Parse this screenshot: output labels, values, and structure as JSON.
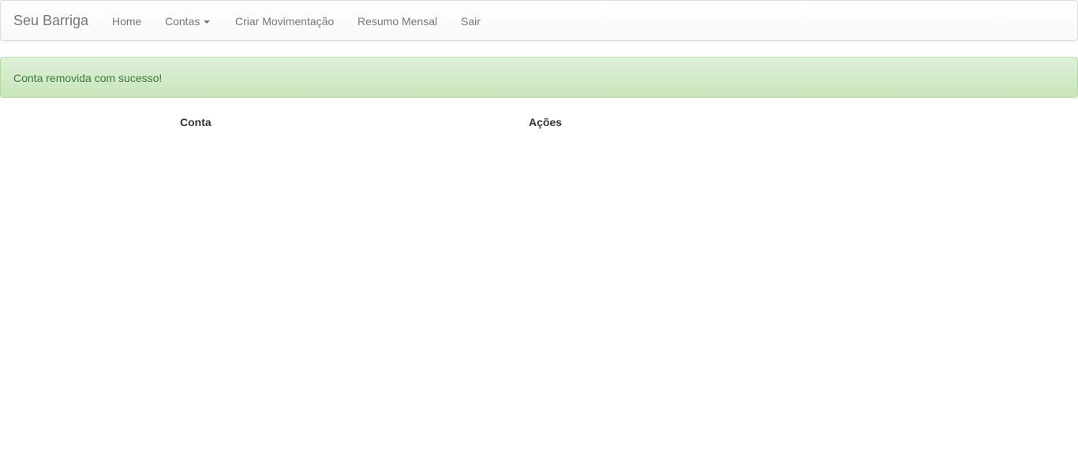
{
  "navbar": {
    "brand": "Seu Barriga",
    "items": [
      {
        "label": "Home"
      },
      {
        "label": "Contas",
        "has_dropdown": true
      },
      {
        "label": "Criar Movimentação"
      },
      {
        "label": "Resumo Mensal"
      },
      {
        "label": "Sair"
      }
    ]
  },
  "alert": {
    "type": "success",
    "message": "Conta removida com sucesso!",
    "color": "#3c763d"
  },
  "table": {
    "headers": [
      "Conta",
      "Ações"
    ],
    "rows": []
  }
}
